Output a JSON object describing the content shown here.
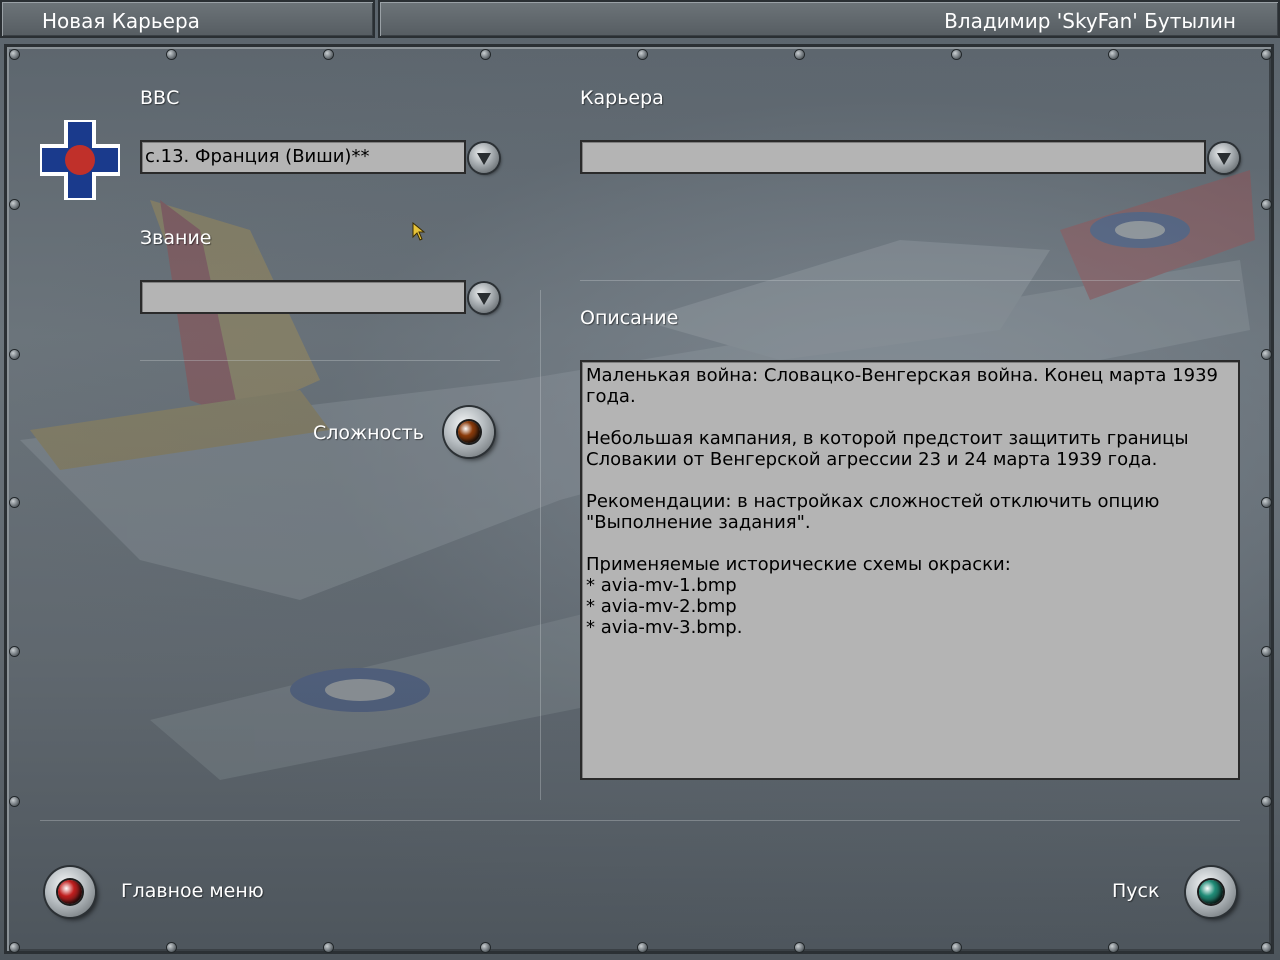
{
  "header": {
    "screen_title": "Новая Карьера",
    "pilot_name": "Владимир 'SkyFan' Бутылин"
  },
  "airforce": {
    "label": "ВВС",
    "selected": "с.13. Франция (Виши)**",
    "emblem_colors": {
      "cross": "#1a3a8c",
      "circle": "#c0302a",
      "border": "#ffffff"
    }
  },
  "career": {
    "label": "Карьера",
    "selected": ""
  },
  "rank": {
    "label": "Звание",
    "selected": ""
  },
  "difficulty": {
    "label": "Сложность"
  },
  "description": {
    "label": "Описание",
    "paragraphs": [
      "Маленькая война: Словацко-Венгерская война. Конец марта 1939 года.",
      "Небольшая кампания, в которой предстоит защитить границы Словакии от Венгерской агрессии 23 и 24 марта 1939 года.",
      "Рекомендации: в настройках сложностей отключить опцию \"Выполнение задания\".",
      "Применяемые исторические схемы окраски:\n* avia-mv-1.bmp\n* avia-mv-2.bmp\n* avia-mv-3.bmp."
    ]
  },
  "footer": {
    "main_menu_label": "Главное меню",
    "start_label": "Пуск"
  },
  "colors": {
    "main_menu_lamp": "#c01e1e",
    "start_lamp": "#1f8c77",
    "difficulty_lamp": "#8a3a0a"
  }
}
